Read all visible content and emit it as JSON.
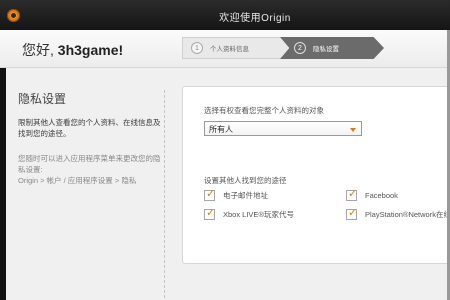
{
  "window": {
    "title": "欢迎使用Origin"
  },
  "header": {
    "greeting_prefix": "您好,",
    "username": "3h3game!",
    "steps": [
      {
        "number": "1",
        "label": "个人资料信息",
        "active": false
      },
      {
        "number": "2",
        "label": "隐私设置",
        "active": true
      }
    ]
  },
  "sidebar": {
    "title": "隐私设置",
    "description": "限制其他人查看您的个人资料、在线信息及找到您的途径。",
    "hint": "您随时可以进入应用程序菜单来更改您的隐私设置:",
    "path": "Origin > 帐户 / 应用程序设置 > 隐私"
  },
  "form": {
    "profile_question": "选择有权查看您完整个人资料的对象",
    "profile_visibility_value": "所有人",
    "find_question": "设置其他人找到您的途径",
    "options": [
      {
        "label": "电子邮件地址",
        "checked": true
      },
      {
        "label": "Facebook",
        "checked": true
      },
      {
        "label": "Xbox LIVE®玩家代号",
        "checked": true
      },
      {
        "label": "PlayStation®Network在线ID",
        "checked": true
      }
    ]
  },
  "colors": {
    "accent": "#e37b1b",
    "active_step": "#6b6b6b",
    "titlebar": "#1e1e1e"
  },
  "icons": {
    "app_logo": "origin-logo-icon",
    "checkbox": "checkmark-icon",
    "dropdown": "chevron-down-icon"
  }
}
